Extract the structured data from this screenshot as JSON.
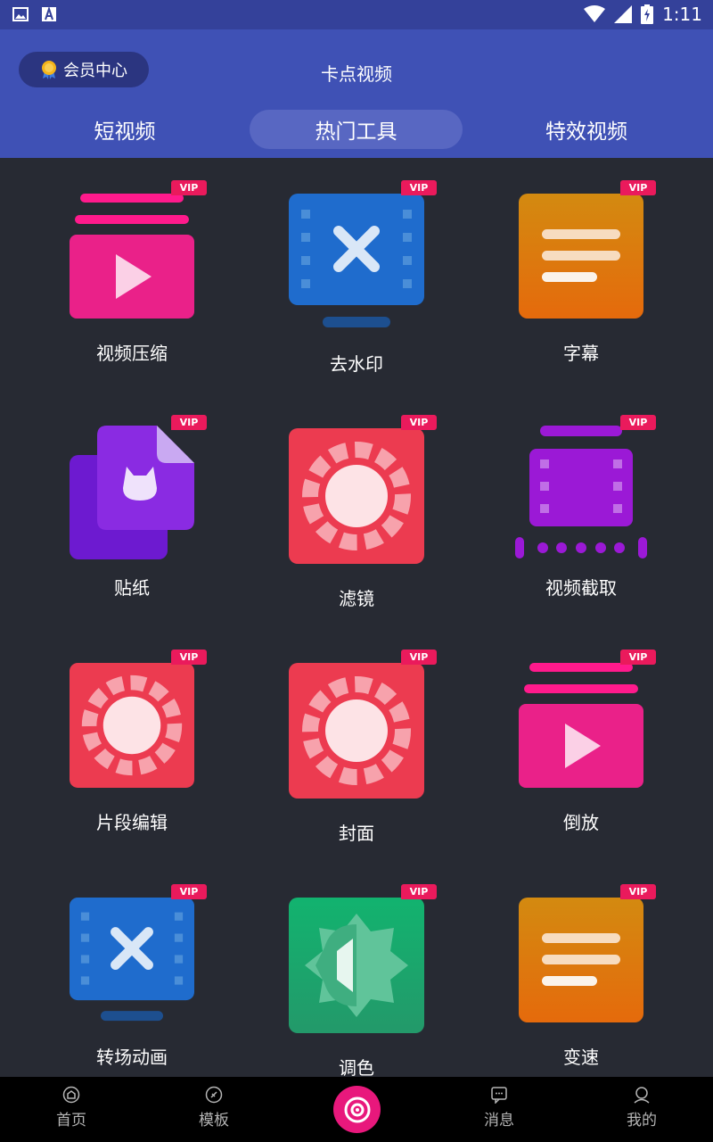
{
  "status_bar": {
    "time": "1:11",
    "icons": [
      "image-icon",
      "text-a-icon",
      "wifi-icon",
      "signal-icon",
      "battery-charging-icon"
    ]
  },
  "header": {
    "member_label": "会员中心",
    "member_icon": "medal-icon",
    "title": "卡点视频"
  },
  "tabs": [
    {
      "label": "短视频",
      "active": false
    },
    {
      "label": "热门工具",
      "active": true
    },
    {
      "label": "特效视频",
      "active": false
    }
  ],
  "vip_label": "VIP",
  "tools": [
    {
      "label": "视频压缩",
      "icon": "video-compress-icon"
    },
    {
      "label": "去水印",
      "icon": "remove-watermark-icon"
    },
    {
      "label": "字幕",
      "icon": "subtitle-icon"
    },
    {
      "label": "贴纸",
      "icon": "sticker-icon"
    },
    {
      "label": "滤镜",
      "icon": "filter-icon"
    },
    {
      "label": "视频截取",
      "icon": "video-trim-icon"
    },
    {
      "label": "片段编辑",
      "icon": "clip-edit-icon"
    },
    {
      "label": "封面",
      "icon": "cover-icon"
    },
    {
      "label": "倒放",
      "icon": "reverse-icon"
    },
    {
      "label": "转场动画",
      "icon": "transition-icon"
    },
    {
      "label": "调色",
      "icon": "color-grade-icon"
    },
    {
      "label": "变速",
      "icon": "speed-icon"
    }
  ],
  "colors": {
    "header": "#3f51b5",
    "status_bar": "#34419a",
    "background": "#272a33",
    "vip": "#ea1a5c",
    "accent": "#e8187c"
  },
  "bottom_nav": [
    {
      "label": "首页",
      "icon": "home-icon"
    },
    {
      "label": "模板",
      "icon": "template-icon"
    },
    {
      "label": "",
      "icon": "camera-icon"
    },
    {
      "label": "消息",
      "icon": "message-icon"
    },
    {
      "label": "我的",
      "icon": "profile-icon"
    }
  ]
}
